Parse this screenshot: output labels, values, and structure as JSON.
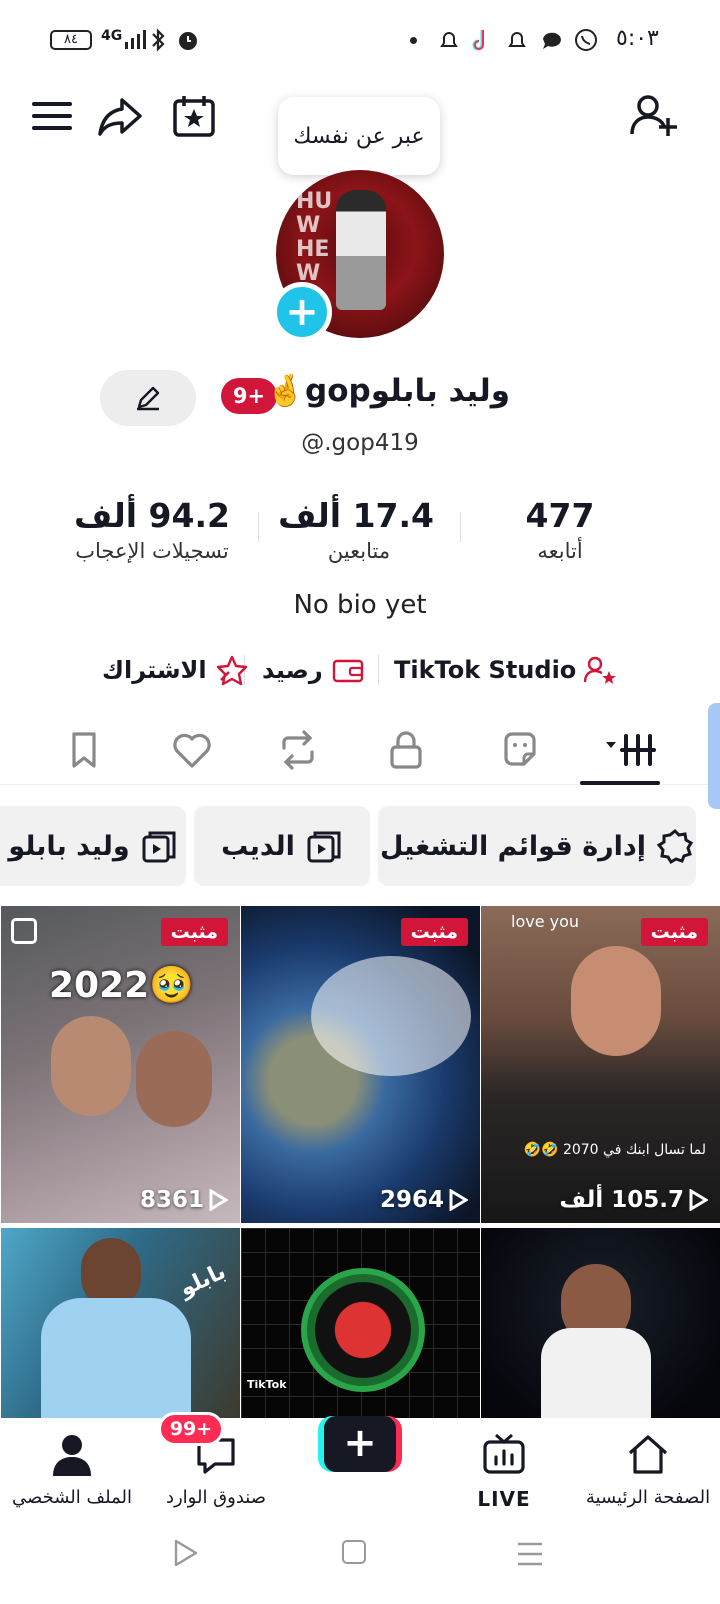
{
  "status_bar": {
    "battery": "٨٤",
    "network": "4G",
    "time": "٥:٠٣"
  },
  "header": {
    "tooltip": "عبر عن نفسك"
  },
  "profile": {
    "name_prefix": "وليد بابلو",
    "name_suffix": "gop",
    "name_emoji": "🤞",
    "badge": "9+",
    "handle": "@.gop419",
    "bio": "No bio yet"
  },
  "stats": [
    {
      "value": "477",
      "label": "أتابعه"
    },
    {
      "value": "17.4 ألف",
      "label": "متابعين"
    },
    {
      "value": "94.2 ألف",
      "label": "تسجيلات الإعجاب"
    }
  ],
  "links": {
    "studio": "TikTok Studio",
    "balance": "رصيد",
    "subscription": "الاشتراك"
  },
  "playlists": [
    {
      "label": "إدارة قوائم التشغيل"
    },
    {
      "label": "الديب"
    },
    {
      "label": "وليد بابلو"
    }
  ],
  "videos": [
    {
      "pinned": "مثبت",
      "views": "105.7 ألف",
      "caption_top": "love you",
      "caption": "لما تسال ابنك في 2070 🤣🤣"
    },
    {
      "pinned": "مثبت",
      "views": "2964"
    },
    {
      "pinned": "مثبت",
      "views": "8361",
      "caption": "2022🥹"
    },
    {
      "views": ""
    },
    {
      "views": "",
      "watermark": "TikTok"
    },
    {
      "views": "",
      "caption": "بابلو"
    }
  ],
  "bottom_nav": {
    "home": "الصفحة الرئيسية",
    "live": "LIVE",
    "inbox": "صندوق الوارد",
    "inbox_badge": "99+",
    "profile": "الملف الشخصي"
  },
  "colors": {
    "accent_red": "#d1163a",
    "accent_cyan": "#21c4e9",
    "text_primary": "#161823"
  }
}
